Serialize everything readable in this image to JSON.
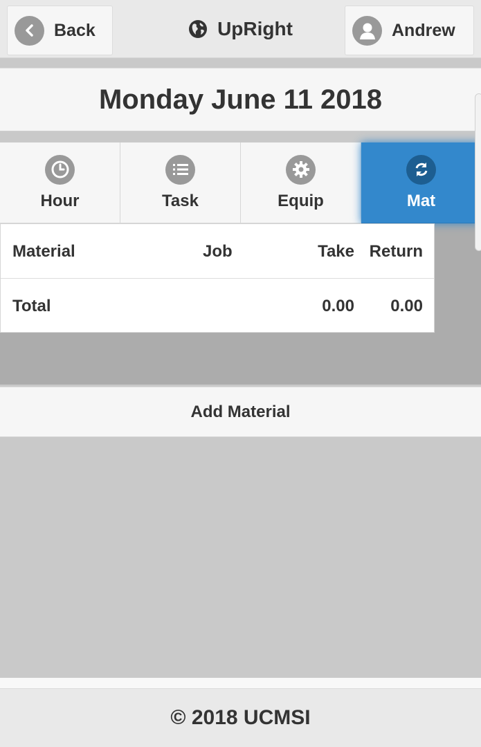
{
  "header": {
    "back_label": "Back",
    "app_title": "UpRight",
    "user_name": "Andrew",
    "back_icon": "chevron-left-icon",
    "title_icon": "globe-icon",
    "user_icon": "user-icon"
  },
  "date_label": "Monday June 11 2018",
  "tabs": [
    {
      "label": "Hour",
      "icon": "clock-icon",
      "active": false
    },
    {
      "label": "Task",
      "icon": "list-icon",
      "active": false
    },
    {
      "label": "Equip",
      "icon": "gear-icon",
      "active": false
    },
    {
      "label": "Mat",
      "icon": "refresh-icon",
      "active": true
    }
  ],
  "table": {
    "headers": {
      "material": "Material",
      "job": "Job",
      "take": "Take",
      "return": "Return"
    },
    "total_row": {
      "label": "Total",
      "take": "0.00",
      "return": "0.00"
    }
  },
  "add_material_label": "Add Material",
  "footer_text": "© 2018 UCMSI",
  "colors": {
    "accent": "#3388cc",
    "icon_gray": "#999999"
  }
}
